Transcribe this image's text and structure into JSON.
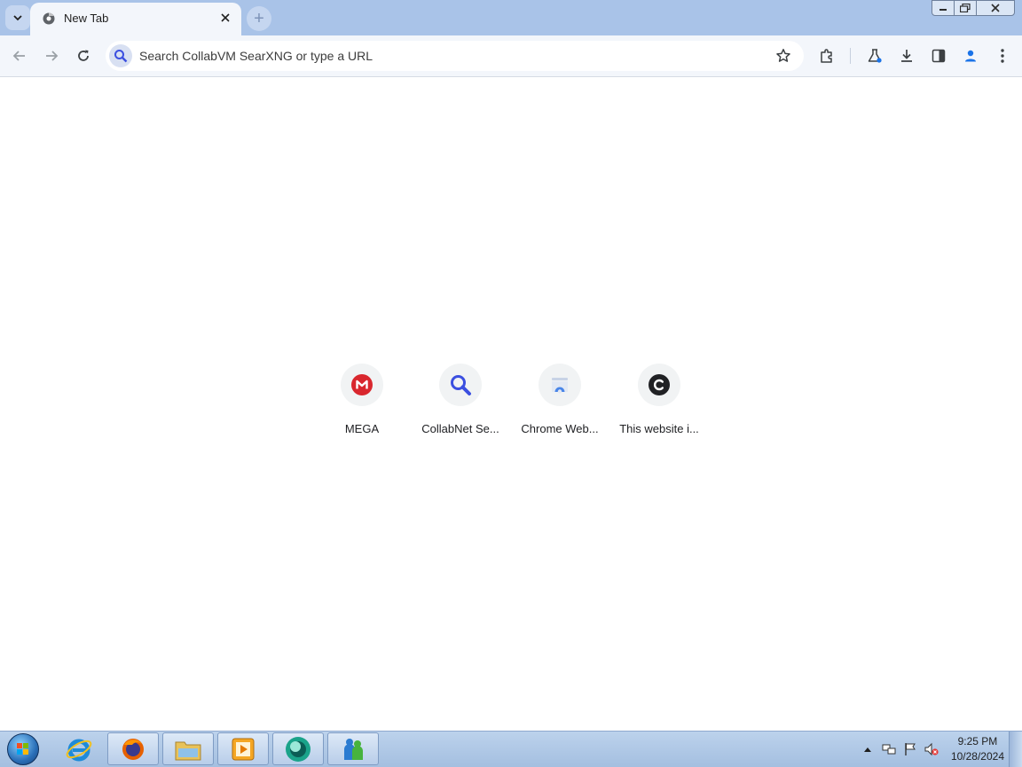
{
  "browser": {
    "tab": {
      "title": "New Tab",
      "favicon": "chrome-globe-icon"
    },
    "new_tab_symbol": "+",
    "omnibox": {
      "text": "Search CollabVM SearXNG or type a URL"
    }
  },
  "shortcuts": [
    {
      "label": "MEGA",
      "icon": "mega-icon",
      "color": "#d9272e",
      "glyph": "M"
    },
    {
      "label": "CollabNet Se...",
      "icon": "search-icon",
      "color": "#3b4fe0"
    },
    {
      "label": "Chrome Web...",
      "icon": "chrome-web-store-icon",
      "color": "#4a86e8"
    },
    {
      "label": "This website i...",
      "icon": "c-letter-icon",
      "color": "#202124",
      "glyph": "C"
    }
  ],
  "taskbar": {
    "apps": [
      "internet-explorer-icon",
      "firefox-icon",
      "file-explorer-icon",
      "media-player-icon",
      "chrome-icon",
      "messenger-icon"
    ],
    "clock": {
      "time": "9:25 PM",
      "date": "10/28/2024"
    }
  },
  "colors": {
    "titlebar": "#a9c3e8",
    "toolbar": "#f3f6fb",
    "accent": "#1a73e8"
  }
}
